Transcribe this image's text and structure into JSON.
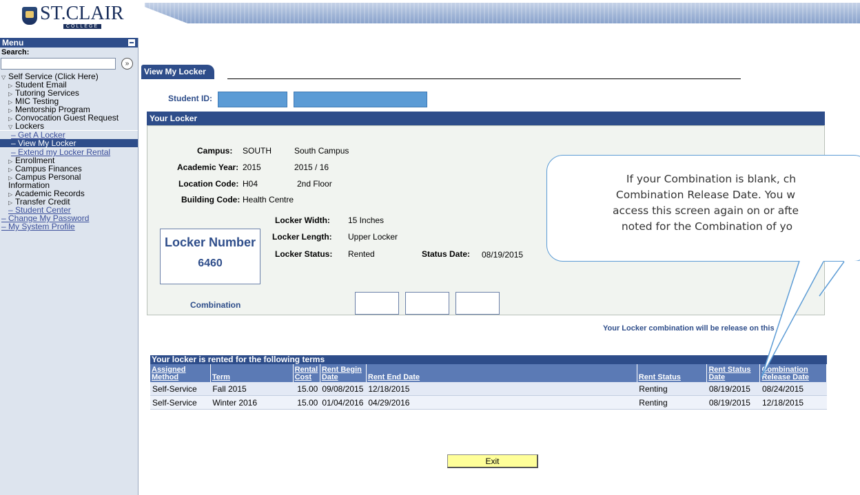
{
  "header": {
    "logo_text": "ST.CLAIR",
    "logo_sub": "COLLEGE"
  },
  "sidebar": {
    "menu_title": "Menu",
    "search_label": "Search:",
    "search_value": "",
    "search_go_glyph": "»",
    "items": [
      {
        "label": "Self Service (Click Here)",
        "expanded": true
      },
      {
        "label": "Student Email"
      },
      {
        "label": "Tutoring Services"
      },
      {
        "label": "MIC Testing"
      },
      {
        "label": "Mentorship Program"
      },
      {
        "label": "Convocation Guest Request"
      },
      {
        "label": "Lockers",
        "expanded": true
      },
      {
        "label": "Get A Locker"
      },
      {
        "label": "View My Locker",
        "selected": true
      },
      {
        "label": "Extend my Locker Rental"
      },
      {
        "label": "Enrollment"
      },
      {
        "label": "Campus Finances"
      },
      {
        "label": "Campus Personal"
      },
      {
        "label": "Information"
      },
      {
        "label": "Academic Records"
      },
      {
        "label": "Transfer Credit"
      },
      {
        "label": "Student Center"
      },
      {
        "label": "Change My Password"
      },
      {
        "label": "My System Profile"
      }
    ]
  },
  "main": {
    "tab_label": "View My Locker",
    "student_id_label": "Student ID:",
    "panel_title": "Your Locker",
    "campus_label": "Campus:",
    "campus_code": "SOUTH",
    "campus_name": "South Campus",
    "year_label": "Academic Year:",
    "year_code": "2015",
    "year_name": "2015 / 16",
    "location_label": "Location Code:",
    "location_code": "H04",
    "location_name": "2nd Floor",
    "building_label": "Building Code:",
    "building_name": "Health Centre",
    "locker_number_title": "Locker Number",
    "locker_number": "6460",
    "width_label": "Locker Width:",
    "width_value": "15 Inches",
    "length_label": "Locker Length:",
    "length_value": "Upper Locker",
    "status_label": "Locker Status:",
    "status_value": "Rented",
    "status_date_label": "Status Date:",
    "status_date_value": "08/19/2015",
    "combination_label": "Combination",
    "release_note": "Your Locker combination will be release on this",
    "terms_title": "Your locker is rented for the following terms",
    "columns": [
      "Assigned Method",
      "Term",
      "Rental Cost",
      "Rent Begin Date",
      "Rent End Date",
      "Rent Status",
      "Rent Status Date",
      "Combination Release Date"
    ],
    "rows": [
      [
        "Self-Service",
        "Fall 2015",
        "15.00",
        "09/08/2015",
        "12/18/2015",
        "Renting",
        "08/19/2015",
        "08/24/2015"
      ],
      [
        "Self-Service",
        "Winter 2016",
        "15.00",
        "01/04/2016",
        "04/29/2016",
        "Renting",
        "08/19/2015",
        "12/18/2015"
      ]
    ],
    "exit_label": "Exit"
  },
  "callout": {
    "lines": [
      "If your Combination is blank, ch",
      "Combination Release Date.  You w",
      "access this screen again on or afte",
      "noted for the Combination of yo"
    ]
  },
  "colors": {
    "accent": "#2e4d8a",
    "highlight": "#5b9bd5",
    "button": "#ffff99"
  }
}
